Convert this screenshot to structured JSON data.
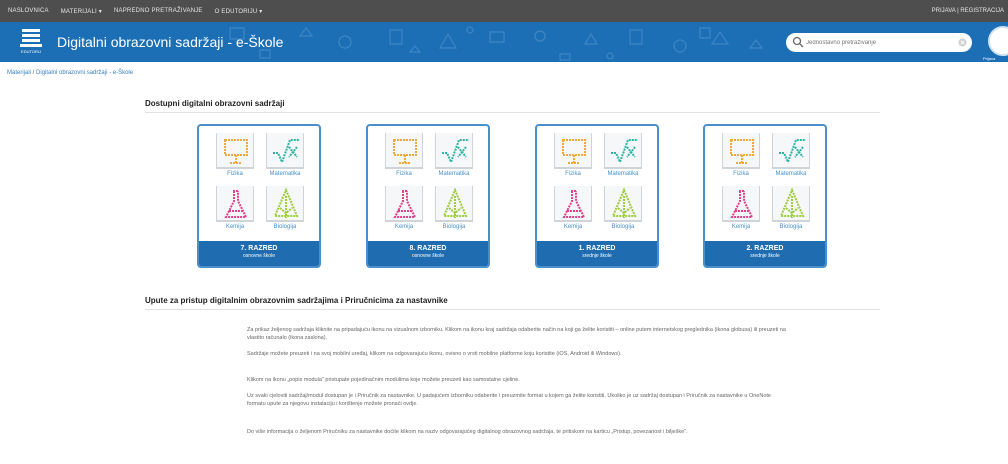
{
  "topbar": {
    "nav": [
      "Naslovnica",
      "Materijali ▾",
      "Napredno pretraživanje",
      "O Edutoriju ▾"
    ],
    "right": "PRIJAVA | REGISTRACIJA"
  },
  "header": {
    "logo_text": "EDUTORIJ",
    "title": "Digitalni obrazovni sadržaji - e-Škole",
    "search_placeholder": "Jednostavno pretraživanje",
    "user_caption": "Prijava"
  },
  "breadcrumb": {
    "link": "Materijali",
    "separator": " / ",
    "current": "Digitalni obrazovni sadržaji - e-Škole"
  },
  "section1": {
    "title": "Dostupni digitalni obrazovni sadržaji"
  },
  "cards": [
    {
      "grade": "7. RAZRED",
      "school": "osnovne škole",
      "subjects": [
        "Fizika",
        "Matematika",
        "Kemija",
        "Biologija"
      ]
    },
    {
      "grade": "8. RAZRED",
      "school": "osnovne škole",
      "subjects": [
        "Fizika",
        "Matematika",
        "Kemija",
        "Biologija"
      ]
    },
    {
      "grade": "1. RAZRED",
      "school": "srednje škole",
      "subjects": [
        "Fizika",
        "Matematika",
        "Kemija",
        "Biologija"
      ]
    },
    {
      "grade": "2. RAZRED",
      "school": "srednje škole",
      "subjects": [
        "Fizika",
        "Matematika",
        "Kemija",
        "Biologija"
      ]
    }
  ],
  "section2": {
    "title": "Upute za pristup digitalnim obrazovnim sadržajima i Priručnicima za nastavnike",
    "paragraphs": [
      "Za prikaz željenog sadržaja kliknite na pripadajuću ikonu na vizualnom izborniku. Klikom na ikonu kraj sadržaja odaberite način na koji ga želite koristiti – online putem internetskog preglednika (ikona globusa) ili preuzeti na vlastito računalo (ikona zaslona).",
      "Sadržaje možete preuzeti i na svoj mobilni uređaj, klikom na odgovarajuću ikonu, ovisno o vrsti mobilne platforme koju koristite (iOS, Android ili Windows).",
      "Klikom na ikonu „popis modula\" pristupate pojedinačnim modulima koje možete preuzeti kao samostalne cjeline.",
      "Uz svaki cjeloviti sadržaj/modul dostupan je i Priručnik za nastavnike. U padajućem izborniku odaberite i preuzmite format u kojem ga želite koristiti. Ukoliko je uz sadržaj dostupan i Priručnik za nastavnike u OneNote formatu upute za njegovu instalaciju i korištenje možete pronaći ovdje.",
      "Do više informacija o željenom Priručniku za nastavnike doćite klikom na naziv odgovarajućeg digitalnog obrazovnog sadržaja, te pritiskom na karticu „Pristup, povezanost i bilješke\"."
    ]
  },
  "colors": {
    "topbar": "#4e4e4e",
    "header": "#1d6fb5",
    "card_border": "#4a90cc",
    "banner": "#1f6db0",
    "fizika_icon": "#f2a73b",
    "matematika_icon": "#2bb3a3",
    "kemija_icon": "#e0408a",
    "biologija_icon": "#9ccc3c"
  },
  "icons": {
    "fizika": "presentation-board-icon",
    "matematika": "square-root-icon",
    "kemija": "flask-icon",
    "biologija": "leaf-icon"
  }
}
